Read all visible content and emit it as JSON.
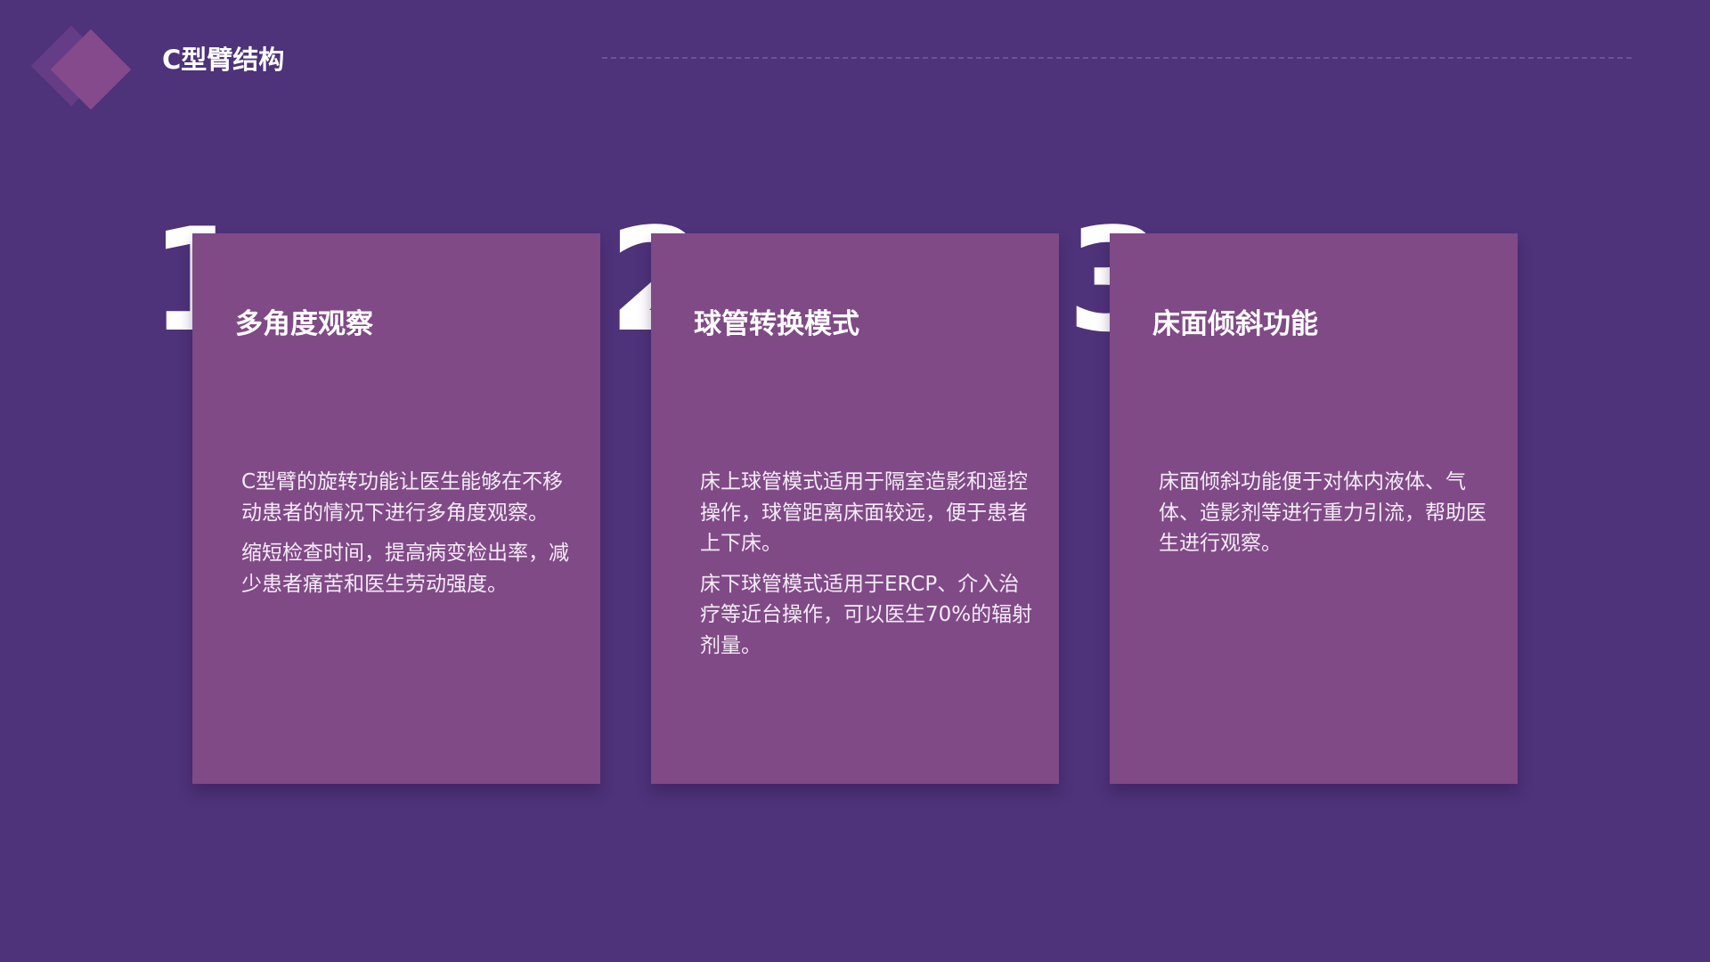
{
  "header": {
    "title": "C型臂结构"
  },
  "cards": [
    {
      "number": "1",
      "title": "多角度观察",
      "paragraphs": [
        "C型臂的旋转功能让医生能够在不移动患者的情况下进行多角度观察。",
        "缩短检查时间，提高病变检出率，减少患者痛苦和医生劳动强度。"
      ]
    },
    {
      "number": "2",
      "title": "球管转换模式",
      "paragraphs": [
        "床上球管模式适用于隔室造影和遥控操作，球管距离床面较远，便于患者上下床。",
        "床下球管模式适用于ERCP、介入治疗等近台操作，可以医生70%的辐射剂量。"
      ]
    },
    {
      "number": "3",
      "title": "床面倾斜功能",
      "paragraphs": [
        "床面倾斜功能便于对体内液体、气体、造影剂等进行重力引流，帮助医生进行观察。"
      ]
    }
  ],
  "colors": {
    "background": "#4e327a",
    "card": "#804a86",
    "text": "#ffffff"
  },
  "icons": {
    "logo": "diamond-logo-icon"
  }
}
